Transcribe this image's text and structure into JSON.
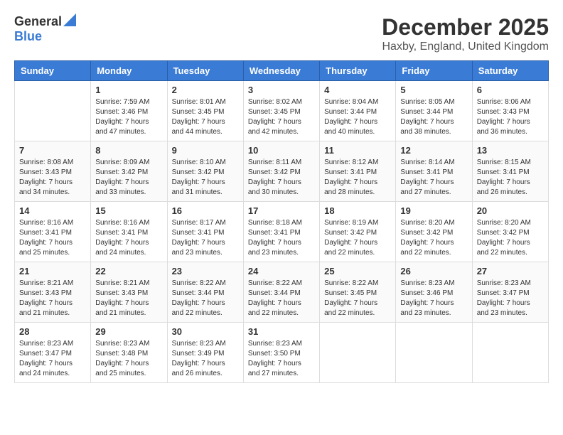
{
  "header": {
    "logo_line1": "General",
    "logo_line2": "Blue",
    "main_title": "December 2025",
    "subtitle": "Haxby, England, United Kingdom"
  },
  "days_of_week": [
    "Sunday",
    "Monday",
    "Tuesday",
    "Wednesday",
    "Thursday",
    "Friday",
    "Saturday"
  ],
  "weeks": [
    [
      {
        "date": "",
        "info": ""
      },
      {
        "date": "1",
        "info": "Sunrise: 7:59 AM\nSunset: 3:46 PM\nDaylight: 7 hours and 47 minutes."
      },
      {
        "date": "2",
        "info": "Sunrise: 8:01 AM\nSunset: 3:45 PM\nDaylight: 7 hours and 44 minutes."
      },
      {
        "date": "3",
        "info": "Sunrise: 8:02 AM\nSunset: 3:45 PM\nDaylight: 7 hours and 42 minutes."
      },
      {
        "date": "4",
        "info": "Sunrise: 8:04 AM\nSunset: 3:44 PM\nDaylight: 7 hours and 40 minutes."
      },
      {
        "date": "5",
        "info": "Sunrise: 8:05 AM\nSunset: 3:44 PM\nDaylight: 7 hours and 38 minutes."
      },
      {
        "date": "6",
        "info": "Sunrise: 8:06 AM\nSunset: 3:43 PM\nDaylight: 7 hours and 36 minutes."
      }
    ],
    [
      {
        "date": "7",
        "info": "Sunrise: 8:08 AM\nSunset: 3:43 PM\nDaylight: 7 hours and 34 minutes."
      },
      {
        "date": "8",
        "info": "Sunrise: 8:09 AM\nSunset: 3:42 PM\nDaylight: 7 hours and 33 minutes."
      },
      {
        "date": "9",
        "info": "Sunrise: 8:10 AM\nSunset: 3:42 PM\nDaylight: 7 hours and 31 minutes."
      },
      {
        "date": "10",
        "info": "Sunrise: 8:11 AM\nSunset: 3:42 PM\nDaylight: 7 hours and 30 minutes."
      },
      {
        "date": "11",
        "info": "Sunrise: 8:12 AM\nSunset: 3:41 PM\nDaylight: 7 hours and 28 minutes."
      },
      {
        "date": "12",
        "info": "Sunrise: 8:14 AM\nSunset: 3:41 PM\nDaylight: 7 hours and 27 minutes."
      },
      {
        "date": "13",
        "info": "Sunrise: 8:15 AM\nSunset: 3:41 PM\nDaylight: 7 hours and 26 minutes."
      }
    ],
    [
      {
        "date": "14",
        "info": "Sunrise: 8:16 AM\nSunset: 3:41 PM\nDaylight: 7 hours and 25 minutes."
      },
      {
        "date": "15",
        "info": "Sunrise: 8:16 AM\nSunset: 3:41 PM\nDaylight: 7 hours and 24 minutes."
      },
      {
        "date": "16",
        "info": "Sunrise: 8:17 AM\nSunset: 3:41 PM\nDaylight: 7 hours and 23 minutes."
      },
      {
        "date": "17",
        "info": "Sunrise: 8:18 AM\nSunset: 3:41 PM\nDaylight: 7 hours and 23 minutes."
      },
      {
        "date": "18",
        "info": "Sunrise: 8:19 AM\nSunset: 3:42 PM\nDaylight: 7 hours and 22 minutes."
      },
      {
        "date": "19",
        "info": "Sunrise: 8:20 AM\nSunset: 3:42 PM\nDaylight: 7 hours and 22 minutes."
      },
      {
        "date": "20",
        "info": "Sunrise: 8:20 AM\nSunset: 3:42 PM\nDaylight: 7 hours and 22 minutes."
      }
    ],
    [
      {
        "date": "21",
        "info": "Sunrise: 8:21 AM\nSunset: 3:43 PM\nDaylight: 7 hours and 21 minutes."
      },
      {
        "date": "22",
        "info": "Sunrise: 8:21 AM\nSunset: 3:43 PM\nDaylight: 7 hours and 21 minutes."
      },
      {
        "date": "23",
        "info": "Sunrise: 8:22 AM\nSunset: 3:44 PM\nDaylight: 7 hours and 22 minutes."
      },
      {
        "date": "24",
        "info": "Sunrise: 8:22 AM\nSunset: 3:44 PM\nDaylight: 7 hours and 22 minutes."
      },
      {
        "date": "25",
        "info": "Sunrise: 8:22 AM\nSunset: 3:45 PM\nDaylight: 7 hours and 22 minutes."
      },
      {
        "date": "26",
        "info": "Sunrise: 8:23 AM\nSunset: 3:46 PM\nDaylight: 7 hours and 23 minutes."
      },
      {
        "date": "27",
        "info": "Sunrise: 8:23 AM\nSunset: 3:47 PM\nDaylight: 7 hours and 23 minutes."
      }
    ],
    [
      {
        "date": "28",
        "info": "Sunrise: 8:23 AM\nSunset: 3:47 PM\nDaylight: 7 hours and 24 minutes."
      },
      {
        "date": "29",
        "info": "Sunrise: 8:23 AM\nSunset: 3:48 PM\nDaylight: 7 hours and 25 minutes."
      },
      {
        "date": "30",
        "info": "Sunrise: 8:23 AM\nSunset: 3:49 PM\nDaylight: 7 hours and 26 minutes."
      },
      {
        "date": "31",
        "info": "Sunrise: 8:23 AM\nSunset: 3:50 PM\nDaylight: 7 hours and 27 minutes."
      },
      {
        "date": "",
        "info": ""
      },
      {
        "date": "",
        "info": ""
      },
      {
        "date": "",
        "info": ""
      }
    ]
  ]
}
